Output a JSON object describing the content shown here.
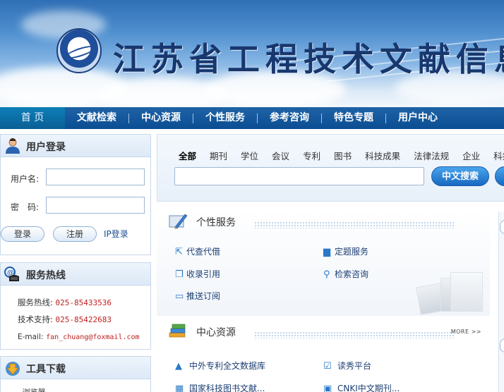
{
  "banner": {
    "title": "江苏省工程技术文献信息"
  },
  "nav": {
    "items": [
      "首 页",
      "文献检索",
      "中心资源",
      "个性服务",
      "参考咨询",
      "特色专题",
      "用户中心"
    ]
  },
  "login": {
    "title": "用户登录",
    "username_label": "用户名:",
    "password_label": "密　码:",
    "username_value": "",
    "password_value": "",
    "login_button": "登录",
    "register_button": "注册",
    "ip_login": "IP登录"
  },
  "hotline": {
    "title": "服务热线",
    "service_label": "服务热线:",
    "service_value": "025-85433536",
    "tech_label": "技术支持:",
    "tech_value": "025-85422683",
    "email_label": "E-mail:",
    "email_value": "fan_chuang@foxmail.com"
  },
  "tools": {
    "title": "工具下载",
    "first_item": "...浏览器"
  },
  "search": {
    "tabs": [
      "全部",
      "期刊",
      "学位",
      "会议",
      "专利",
      "图书",
      "科技成果",
      "法律法规",
      "企业",
      "科技"
    ],
    "active_tab": "全部",
    "query": "",
    "button": "中文搜索"
  },
  "services": {
    "title": "个性服务",
    "items": [
      "代查代借",
      "定题服务",
      "收录引用",
      "检索咨询",
      "推送订阅"
    ]
  },
  "resources": {
    "title": "中心资源",
    "more": "MORE >>",
    "items": [
      "中外专利全文数据库",
      "读秀平台",
      "国家科技图书文献...",
      "CNKI中文期刊..."
    ]
  },
  "colors": {
    "nav_bg": "#0b4d92",
    "accent": "#1769c1",
    "phone_text": "#c02020"
  }
}
